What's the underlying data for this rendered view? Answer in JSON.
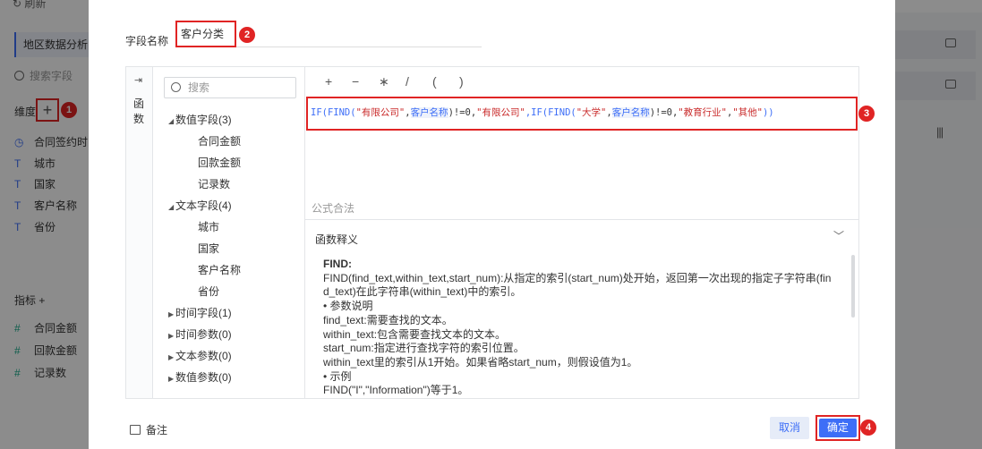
{
  "background": {
    "toolbar": {
      "refresh_label": "刷新"
    },
    "tab_label": "地区数据分析",
    "search_placeholder": "搜索字段",
    "dimension_label": "维度",
    "dimension_fields": [
      "合同签约时",
      "城市",
      "国家",
      "客户名称",
      "省份"
    ],
    "metric_label": "指标",
    "metric_fields": [
      "合同金额",
      "回款金额",
      "记录数"
    ]
  },
  "dialog": {
    "field_name_label": "字段名称",
    "field_name_value": "客户分类",
    "fn_strip_label": "函数",
    "tree_search_placeholder": "搜索",
    "tree": {
      "numeric_group": "数值字段(3)",
      "numeric_items": [
        "合同金额",
        "回款金额",
        "记录数"
      ],
      "text_group": "文本字段(4)",
      "text_items": [
        "城市",
        "国家",
        "客户名称",
        "省份"
      ],
      "time_group": "时间字段(1)",
      "time_param": "时间参数(0)",
      "text_param": "文本参数(0)",
      "num_param": "数值参数(0)"
    },
    "operators": [
      "+",
      "−",
      "∗",
      "/",
      "(",
      ")"
    ],
    "formula": {
      "p1": "IF(FIND(",
      "s1": "\"有限公司\"",
      "c1": ",",
      "f1": "客户名称",
      "p2": ")!=0,",
      "s2": "\"有限公司\"",
      "p3": ",IF(FIND(",
      "s3": "\"大学\"",
      "c2": ",",
      "f2": "客户名称",
      "p4": ")!=0,",
      "s4": "\"教育行业\"",
      "c3": ",",
      "s5": "\"其他\"",
      "p5": "))"
    },
    "formula_status": "公式合法",
    "fn_desc_title": "函数释义",
    "fn_desc": {
      "name": "FIND:",
      "line1": "FIND(find_text,within_text,start_num):从指定的索引(start_num)处开始，返回第一次出现的指定子字符串(fin",
      "line2": "d_text)在此字符串(within_text)中的索引。",
      "line3": "• 参数说明",
      "line4": "find_text:需要查找的文本。",
      "line5": "within_text:包含需要查找文本的文本。",
      "line6": "start_num:指定进行查找字符的索引位置。",
      "line7": "within_text里的索引从1开始。如果省略start_num，则假设值为1。",
      "line8": "• 示例",
      "line9": "FIND(\"I\",\"Information\")等于1。"
    },
    "note_label": "备注",
    "cancel_label": "取消",
    "ok_label": "确定"
  },
  "annotations": [
    "1",
    "2",
    "3",
    "4"
  ],
  "colors": {
    "accent": "#3d6ef7",
    "highlight_red": "#e02424"
  }
}
